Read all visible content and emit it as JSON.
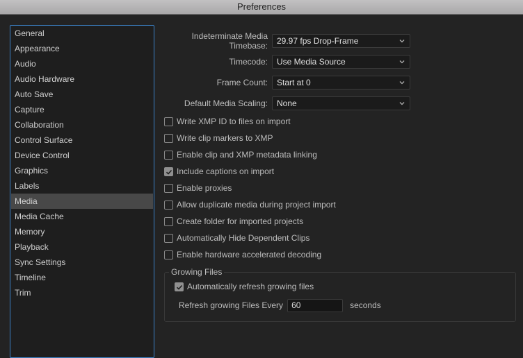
{
  "window": {
    "title": "Preferences"
  },
  "sidebar": {
    "selected": "Media",
    "items": [
      {
        "label": "General"
      },
      {
        "label": "Appearance"
      },
      {
        "label": "Audio"
      },
      {
        "label": "Audio Hardware"
      },
      {
        "label": "Auto Save"
      },
      {
        "label": "Capture"
      },
      {
        "label": "Collaboration"
      },
      {
        "label": "Control Surface"
      },
      {
        "label": "Device Control"
      },
      {
        "label": "Graphics"
      },
      {
        "label": "Labels"
      },
      {
        "label": "Media"
      },
      {
        "label": "Media Cache"
      },
      {
        "label": "Memory"
      },
      {
        "label": "Playback"
      },
      {
        "label": "Sync Settings"
      },
      {
        "label": "Timeline"
      },
      {
        "label": "Trim"
      }
    ]
  },
  "settings": {
    "selects": [
      {
        "label": "Indeterminate Media Timebase:",
        "value": "29.97 fps Drop-Frame",
        "icon": "chevron-down-icon"
      },
      {
        "label": "Timecode:",
        "value": "Use Media Source",
        "icon": "chevron-down-icon"
      },
      {
        "label": "Frame Count:",
        "value": "Start at 0",
        "icon": "chevron-down-icon"
      },
      {
        "label": "Default Media Scaling:",
        "value": "None",
        "icon": "chevron-down-icon"
      }
    ],
    "checkboxes": [
      {
        "label": "Write XMP ID to files on import",
        "checked": false
      },
      {
        "label": "Write clip markers to XMP",
        "checked": false
      },
      {
        "label": "Enable clip and XMP metadata linking",
        "checked": false
      },
      {
        "label": "Include captions on import",
        "checked": true
      },
      {
        "label": "Enable proxies",
        "checked": false
      },
      {
        "label": "Allow duplicate media during project import",
        "checked": false
      },
      {
        "label": "Create folder for imported projects",
        "checked": false
      },
      {
        "label": "Automatically Hide Dependent Clips",
        "checked": false
      },
      {
        "label": "Enable hardware accelerated decoding",
        "checked": false
      }
    ],
    "growing_files": {
      "title": "Growing Files",
      "auto_refresh": {
        "label": "Automatically refresh growing files",
        "checked": true
      },
      "refresh_label": "Refresh growing Files Every",
      "refresh_value": "60",
      "refresh_unit": "seconds"
    }
  }
}
